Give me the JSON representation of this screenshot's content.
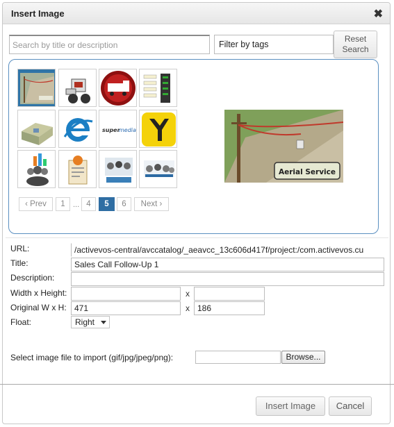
{
  "dialog": {
    "title": "Insert Image"
  },
  "search": {
    "placeholder": "Search by title or description",
    "tags_label": "Filter by tags",
    "reset_label": "Reset\nSearch"
  },
  "gallery": {
    "thumbnails": [
      "aerial-service",
      "bobcat-loader",
      "fire-truck",
      "checklist",
      "house-diagram",
      "ie-logo",
      "supermedia-logo",
      "yellow-pages-logo",
      "social-people",
      "clipboard-person",
      "people-group",
      "people-meeting"
    ],
    "selected": "aerial-service",
    "preview": {
      "caption": "Aerial Service"
    }
  },
  "pagination": {
    "prev": "‹ Prev",
    "pages": [
      "1",
      "4",
      "5",
      "6"
    ],
    "ellipsis": "...",
    "current": "5",
    "next": "Next ›"
  },
  "form": {
    "url_label": "URL:",
    "url_value": "/activevos-central/avccatalog/_aeavcc_13c606d417f/project:/com.activevos.cu",
    "title_label": "Title:",
    "title_value": "Sales Call Follow-Up 1",
    "description_label": "Description:",
    "description_value": "",
    "size_label": "Width x Height:",
    "width_value": "",
    "height_value": "",
    "orig_label": "Original W x H:",
    "orig_width": "471",
    "orig_height": "186",
    "times": "x",
    "float_label": "Float:",
    "float_value": "Right",
    "import_label": "Select image file to import (gif/jpg/jpeg/png):",
    "browse_label": "Browse..."
  },
  "buttons": {
    "insert": "Insert Image",
    "cancel": "Cancel"
  }
}
